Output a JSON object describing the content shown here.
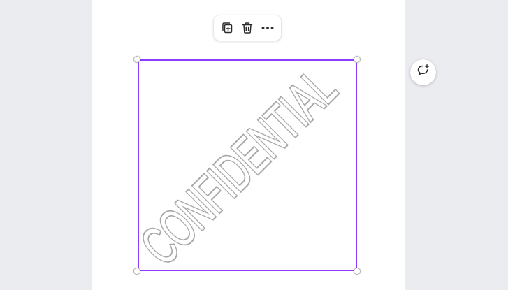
{
  "canvas": {
    "background_color": "#ebecf0",
    "page_color": "#ffffff"
  },
  "toolbar": {
    "buttons": [
      {
        "icon": "duplicate-icon"
      },
      {
        "icon": "trash-icon"
      },
      {
        "icon": "more-icon"
      }
    ]
  },
  "selection": {
    "outline_color": "#8b3dff",
    "handle_color": "#ffffff"
  },
  "element": {
    "text": "CONFIDENTIAL",
    "text_color": "#a7a7a7"
  },
  "side_actions": {
    "comment_icon": "add-comment-icon"
  }
}
